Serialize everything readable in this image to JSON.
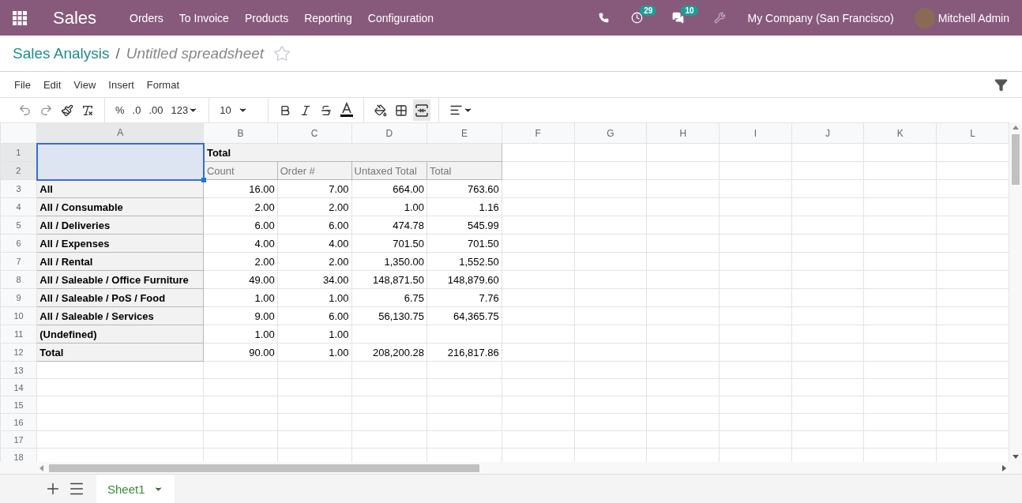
{
  "navbar": {
    "app_name": "Sales",
    "menu": [
      "Orders",
      "To Invoice",
      "Products",
      "Reporting",
      "Configuration"
    ],
    "activity_count": "29",
    "message_count": "10",
    "company": "My Company (San Francisco)",
    "user": "Mitchell Admin"
  },
  "breadcrumb": {
    "parent": "Sales Analysis",
    "separator": "/",
    "current": "Untitled spreadsheet",
    "favorite": false
  },
  "menu_bar": [
    "File",
    "Edit",
    "View",
    "Insert",
    "Format"
  ],
  "toolbar": {
    "percent": "%",
    "decimal_less": ".0",
    "decimal_more": ".00",
    "number_format": "123",
    "font_size": "10",
    "merge_active": true
  },
  "sheet": {
    "columns": [
      "A",
      "B",
      "C",
      "D",
      "E",
      "F",
      "G",
      "H",
      "I",
      "J",
      "K",
      "L"
    ],
    "header_selected": true,
    "rows": [
      {
        "number": "1",
        "kind": "group_header",
        "label": "Total"
      },
      {
        "number": "2",
        "kind": "measure_header",
        "cells": [
          "Count",
          "Order #",
          "Untaxed Total",
          "Total"
        ]
      },
      {
        "number": "3",
        "kind": "data",
        "label": "All",
        "cells": [
          "16.00",
          "7.00",
          "664.00",
          "763.60"
        ]
      },
      {
        "number": "4",
        "kind": "data",
        "label": "All / Consumable",
        "cells": [
          "2.00",
          "2.00",
          "1.00",
          "1.16"
        ]
      },
      {
        "number": "5",
        "kind": "data",
        "label": "All / Deliveries",
        "cells": [
          "6.00",
          "6.00",
          "474.78",
          "545.99"
        ]
      },
      {
        "number": "6",
        "kind": "data",
        "label": "All / Expenses",
        "cells": [
          "4.00",
          "4.00",
          "701.50",
          "701.50"
        ]
      },
      {
        "number": "7",
        "kind": "data",
        "label": "All / Rental",
        "cells": [
          "2.00",
          "2.00",
          "1,350.00",
          "1,552.50"
        ]
      },
      {
        "number": "8",
        "kind": "data",
        "label": "All / Saleable / Office Furniture",
        "cells": [
          "49.00",
          "34.00",
          "148,871.50",
          "148,879.60"
        ]
      },
      {
        "number": "9",
        "kind": "data",
        "label": "All / Saleable / PoS / Food",
        "cells": [
          "1.00",
          "1.00",
          "6.75",
          "7.76"
        ]
      },
      {
        "number": "10",
        "kind": "data",
        "label": "All / Saleable / Services",
        "cells": [
          "9.00",
          "6.00",
          "56,130.75",
          "64,365.75"
        ]
      },
      {
        "number": "11",
        "kind": "data",
        "label": "(Undefined)",
        "cells": [
          "1.00",
          "1.00"
        ]
      },
      {
        "number": "12",
        "kind": "data",
        "label": "Total",
        "cells": [
          "90.00",
          "1.00",
          "208,200.28",
          "216,817.86"
        ]
      },
      {
        "number": "13",
        "kind": "empty"
      },
      {
        "number": "14",
        "kind": "empty"
      },
      {
        "number": "15",
        "kind": "empty"
      },
      {
        "number": "16",
        "kind": "empty"
      },
      {
        "number": "17",
        "kind": "empty"
      },
      {
        "number": "18",
        "kind": "empty"
      }
    ]
  },
  "sheet_tabs": [
    {
      "label": "Sheet1",
      "selected": true
    }
  ]
}
